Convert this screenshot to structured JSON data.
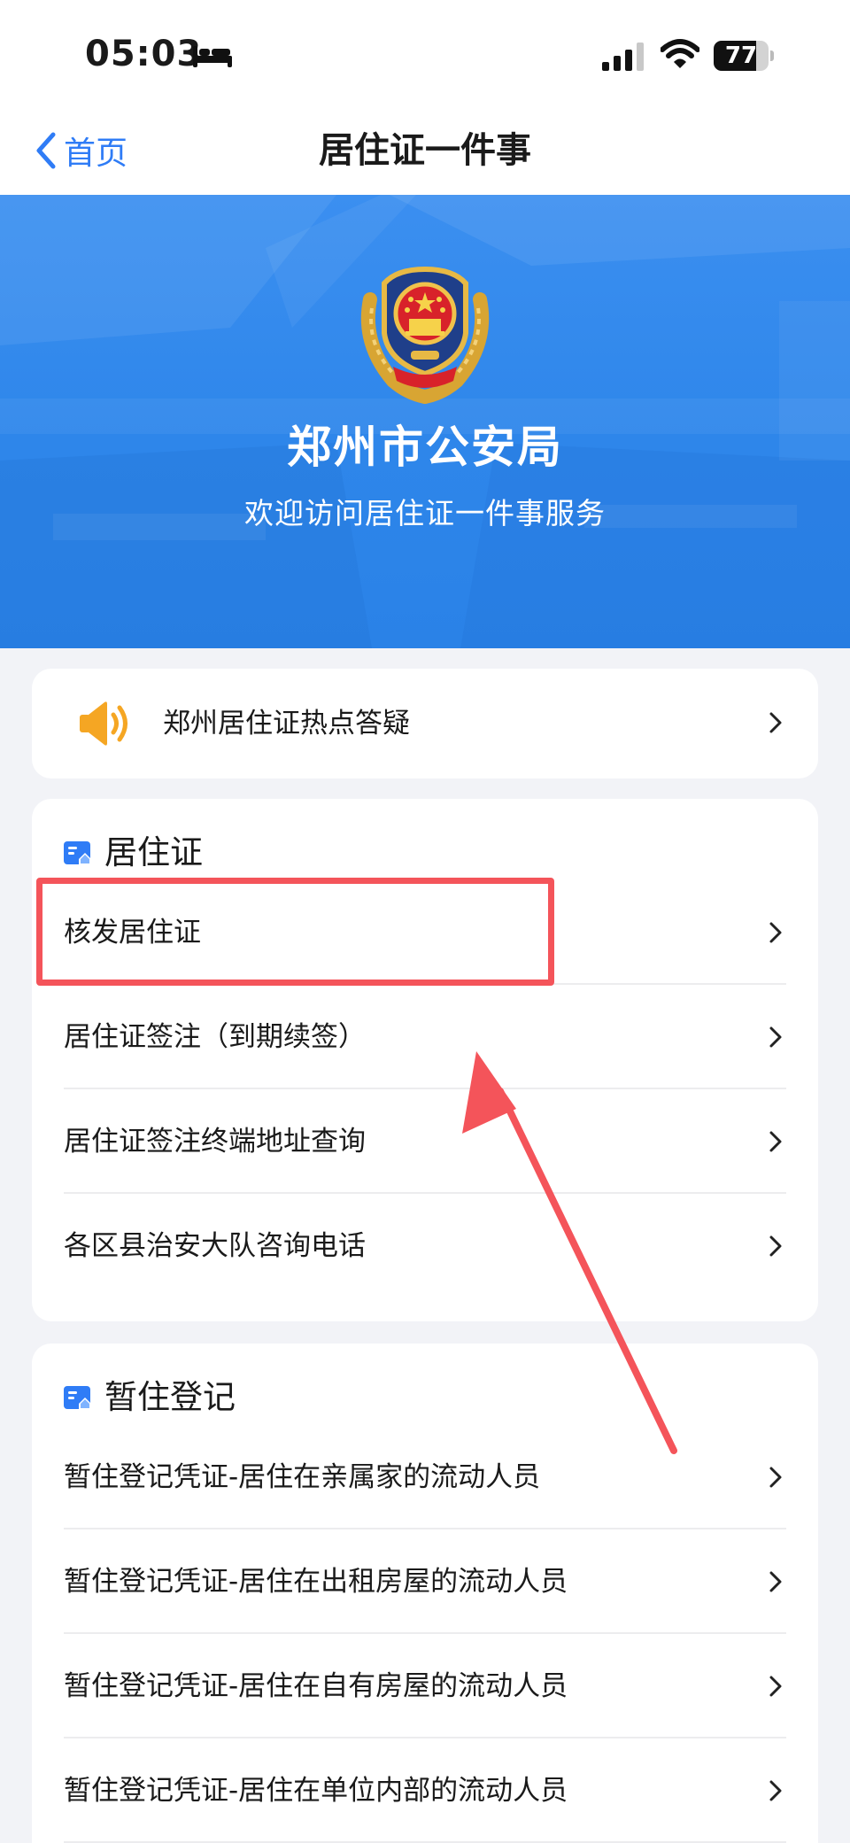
{
  "status_bar": {
    "time": "05:03",
    "battery_level": "77",
    "battery_fraction": 0.77,
    "icons": [
      "bed-icon",
      "cellular-signal-icon",
      "wifi-icon",
      "battery-icon"
    ]
  },
  "nav": {
    "back_label": "首页",
    "title": "居住证一件事",
    "accent_color": "#2f7cf6"
  },
  "banner": {
    "title": "郑州市公安局",
    "subtitle": "欢迎访问居住证一件事服务",
    "background_color": "#2e86ea",
    "emblem_icon": "police-emblem-icon"
  },
  "hot_topics": {
    "label": "郑州居住证热点答疑",
    "icon": "speaker-icon"
  },
  "residence_permit": {
    "title": "居住证",
    "items": [
      {
        "label": "核发居住证"
      },
      {
        "label": "居住证签注（到期续签）"
      },
      {
        "label": "居住证签注终端地址查询"
      },
      {
        "label": "各区县治安大队咨询电话"
      }
    ]
  },
  "temporary_residence": {
    "title": "暂住登记",
    "items": [
      {
        "label": "暂住登记凭证-居住在亲属家的流动人员"
      },
      {
        "label": "暂住登记凭证-居住在出租房屋的流动人员"
      },
      {
        "label": "暂住登记凭证-居住在自有房屋的流动人员"
      },
      {
        "label": "暂住登记凭证-居住在单位内部的流动人员"
      }
    ]
  },
  "annotation": {
    "highlight_color": "#f4545a",
    "highlighted_item": "核发居住证"
  }
}
